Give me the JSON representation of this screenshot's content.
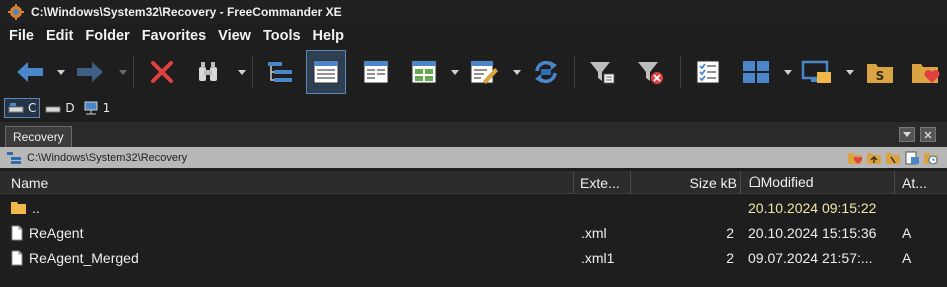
{
  "window": {
    "title": "C:\\Windows\\System32\\Recovery - FreeCommander XE"
  },
  "menu": [
    "File",
    "Edit",
    "Folder",
    "Favorites",
    "View",
    "Tools",
    "Help"
  ],
  "drives": [
    {
      "label": "C",
      "icon": "hard-drive-icon"
    },
    {
      "label": "D",
      "icon": "hard-drive-icon"
    },
    {
      "label": "1",
      "icon": "network-drive-icon"
    }
  ],
  "tab": {
    "label": "Recovery"
  },
  "path": "C:\\Windows\\System32\\Recovery",
  "columns": {
    "name": "Name",
    "ext": "Exte...",
    "size": "Size kB",
    "modified": "ᗝModified",
    "attr": "At..."
  },
  "files": [
    {
      "name": "..",
      "ext": "",
      "size": "",
      "modified": "20.10.2024 09:15:22",
      "attr": "",
      "type": "folder"
    },
    {
      "name": "ReAgent",
      "ext": ".xml",
      "size": "2",
      "modified": "20.10.2024 15:15:36",
      "attr": "A",
      "type": "file"
    },
    {
      "name": "ReAgent_Merged",
      "ext": ".xml1",
      "size": "2",
      "modified": "09.07.2024 21:57:...",
      "attr": "A",
      "type": "file"
    }
  ],
  "colors": {
    "accent": "#4a86c8",
    "path_bar": "#b7b7b7",
    "folder": "#f0b84a",
    "delete_red": "#e04040"
  }
}
